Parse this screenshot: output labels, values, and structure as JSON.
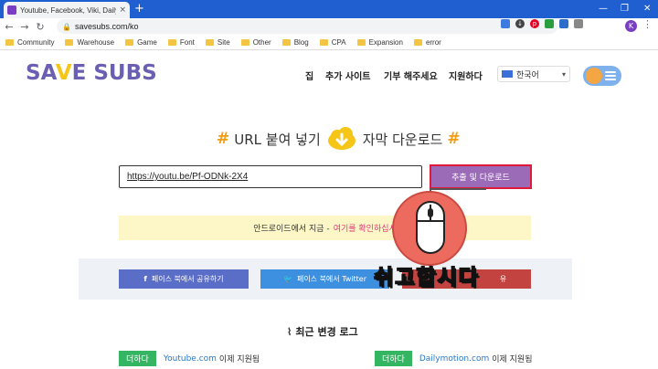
{
  "browser": {
    "tab_title": "Youtube, Facebook, Viki, Dailym",
    "tab_close": "×",
    "new_tab": "+",
    "window_controls": [
      "—",
      "❐",
      "✕"
    ],
    "url": "savesubs.com/ko",
    "profile_initial": "K",
    "bookmarks": [
      "Community",
      "Warehouse",
      "Game",
      "Font",
      "Site",
      "Other",
      "Blog",
      "CPA",
      "Expansion",
      "error"
    ]
  },
  "site": {
    "logo_part1": "SA",
    "logo_part2": "V",
    "logo_part3": "E SUBS",
    "nav": [
      "집",
      "추가 사이트",
      "기부 해주세요",
      "지원하다"
    ],
    "language": "한국어"
  },
  "hero": {
    "hash": "#",
    "headline_left": "URL 붙여 넣기",
    "headline_right": "자막 다운로드",
    "input_value": "https://youtu.be/Pf-ODNk-2X4",
    "extract_button": "추출 및 다운로드",
    "notice_text": "안드로이드에서 지금 -",
    "notice_link": "여기를 확인하십시",
    "share_facebook": "페이스 북에서 공유하기",
    "share_twitter": "페이스 북에서 Twitter",
    "share_third": "유"
  },
  "changelog": {
    "title": "최근 변경 로그",
    "rows": [
      {
        "badge": "더하다",
        "link": "Youtube.com",
        "text": "이제 지원됨"
      },
      {
        "badge": "더하다",
        "link": "Dailymotion.com",
        "text": "이제 지원됨"
      }
    ]
  },
  "overlay": {
    "caption": "쉬고합시다"
  },
  "colors": {
    "accent_purple": "#9b6bb8",
    "highlight_red": "#e0183a",
    "facebook_blue": "#5b6ec7",
    "twitter_blue": "#3d8fe0",
    "badge_green": "#34b562"
  }
}
